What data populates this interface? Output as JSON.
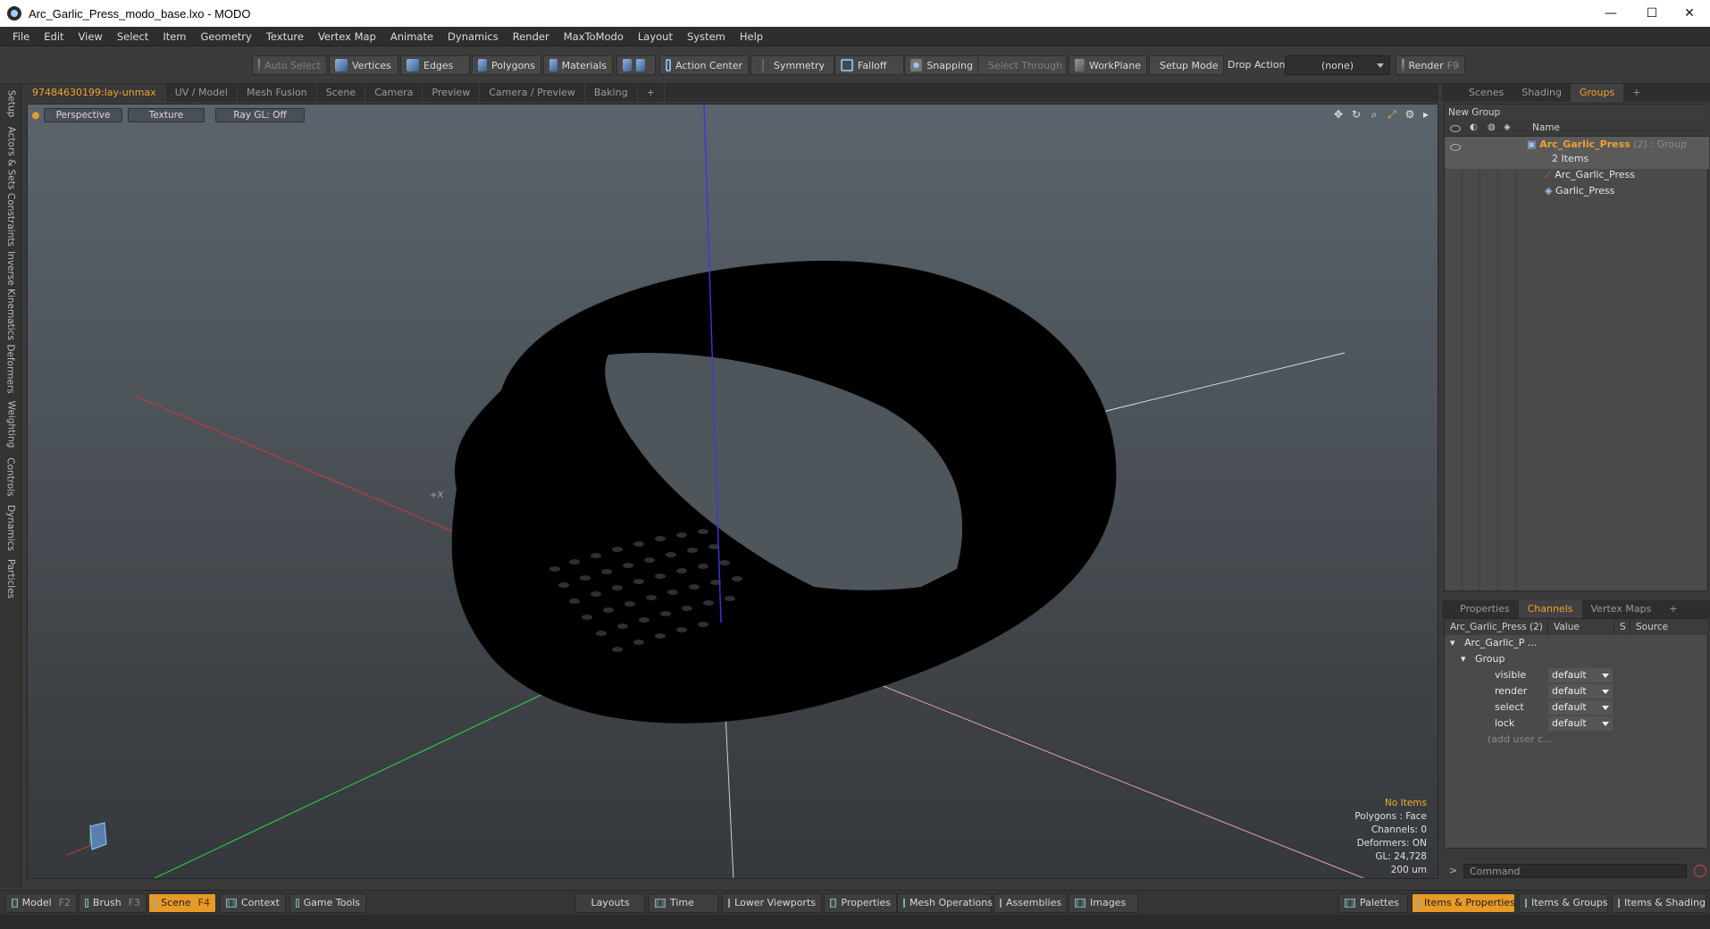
{
  "window": {
    "title": "Arc_Garlic_Press_modo_base.lxo - MODO",
    "minimize": "—",
    "maximize": "☐",
    "close": "✕"
  },
  "menu": [
    "File",
    "Edit",
    "View",
    "Select",
    "Item",
    "Geometry",
    "Texture",
    "Vertex Map",
    "Animate",
    "Dynamics",
    "Render",
    "MaxToModo",
    "Layout",
    "System",
    "Help"
  ],
  "toolbar": {
    "auto_select": "Auto Select",
    "vertices": "Vertices",
    "edges": "Edges",
    "polygons": "Polygons",
    "materials": "Materials",
    "action_center": "Action Center",
    "symmetry": "Symmetry",
    "falloff": "Falloff",
    "snapping": "Snapping",
    "select_through": "Select Through",
    "workplane": "WorkPlane",
    "setup_mode": "Setup Mode",
    "drop_action_label": "Drop Action",
    "drop_action_value": "(none)",
    "render": "Render",
    "render_key": "F9"
  },
  "left_tabs": [
    "Setup",
    "Actors & Sets",
    "Constraints",
    "Inverse Kinematics",
    "Deformers",
    "Weighting",
    "Controls",
    "Dynamics",
    "Particles"
  ],
  "viewport_tabs": [
    "97484630199:lay-unmax",
    "UV / Model",
    "Mesh Fusion",
    "Scene",
    "Camera",
    "Preview",
    "Camera / Preview",
    "Baking",
    "+"
  ],
  "viewport": {
    "view_mode": "Perspective",
    "shading": "Texture",
    "raygl": "Ray GL: Off",
    "axis_marker": "+X",
    "info": {
      "items": "No Items",
      "polygons": "Polygons : Face",
      "channels": "Channels: 0",
      "deformers": "Deformers: ON",
      "gl": "GL: 24,728",
      "scale": "200 um"
    }
  },
  "right_top_tabs": [
    "Scenes",
    "Shading",
    "Groups",
    "+"
  ],
  "groups": {
    "new_group": "New Group",
    "col_name": "Name",
    "root_name": "Arc_Garlic_Press",
    "root_suffix": " (2) : Group",
    "root_count": "2 Items",
    "children": [
      "Arc_Garlic_Press",
      "Garlic_Press"
    ]
  },
  "right_bottom_tabs": [
    "Properties",
    "Channels",
    "Vertex Maps",
    "+"
  ],
  "channels": {
    "col_item": "Arc_Garlic_Press (2)",
    "col_value": "Value",
    "col_s": "S",
    "col_source": "Source",
    "root": "Arc_Garlic_P ...",
    "group": "Group",
    "rows": [
      {
        "name": "visible",
        "value": "default"
      },
      {
        "name": "render",
        "value": "default"
      },
      {
        "name": "select",
        "value": "default"
      },
      {
        "name": "lock",
        "value": "default"
      }
    ],
    "add_user": "(add user c..."
  },
  "command": {
    "placeholder": "Command"
  },
  "bottom": {
    "model": "Model",
    "model_key": "F2",
    "brush": "Brush",
    "brush_key": "F3",
    "scene": "Scene",
    "scene_key": "F4",
    "context": "Context",
    "game_tools": "Game Tools",
    "layouts": "Layouts",
    "time": "Time",
    "lower_viewports": "Lower Viewports",
    "properties": "Properties",
    "mesh_operations": "Mesh Operations",
    "assemblies": "Assemblies",
    "images": "Images",
    "palettes": "Palettes",
    "items_properties": "Items & Properties",
    "items_groups": "Items & Groups",
    "items_shading": "Items & Shading"
  },
  "colors": {
    "accent": "#e79a26",
    "x_axis": "#c33a3a",
    "y_axis": "#3a3ae0",
    "z_axis": "#2fbf4a"
  }
}
